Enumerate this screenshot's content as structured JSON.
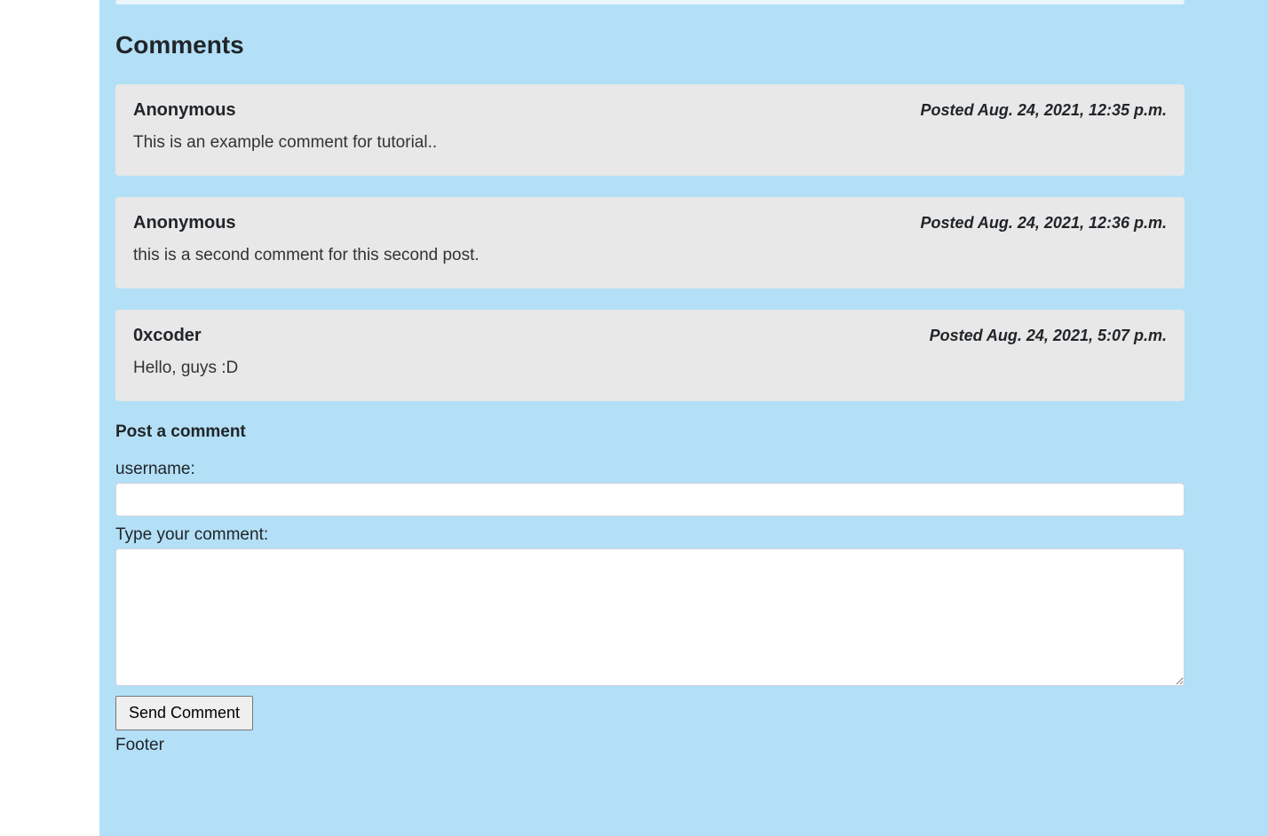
{
  "heading": "Comments",
  "comments": [
    {
      "author": "Anonymous",
      "posted": "Posted Aug. 24, 2021, 12:35 p.m.",
      "body": "This is an example comment for tutorial.."
    },
    {
      "author": "Anonymous",
      "posted": "Posted Aug. 24, 2021, 12:36 p.m.",
      "body": "this is a second comment for this second post."
    },
    {
      "author": "0xcoder",
      "posted": "Posted Aug. 24, 2021, 5:07 p.m.",
      "body": "Hello, guys :D"
    }
  ],
  "form": {
    "heading": "Post a comment",
    "username_label": "username:",
    "username_value": "",
    "comment_label": "Type your comment:",
    "comment_value": "",
    "submit_label": "Send Comment"
  },
  "footer": "Footer"
}
